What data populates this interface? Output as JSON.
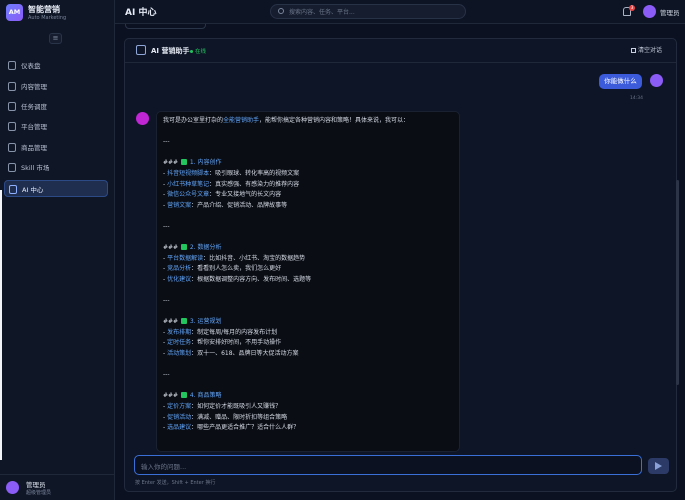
{
  "brand": {
    "logo": "AM",
    "name": "智能营销",
    "subtitle": "Auto Marketing"
  },
  "sidebar": {
    "collapse_icon": "≡",
    "items": [
      {
        "label": "仪表盘",
        "icon": "dashboard-icon",
        "active": false
      },
      {
        "label": "内容管理",
        "icon": "document-icon",
        "active": false
      },
      {
        "label": "任务调度",
        "icon": "clock-icon",
        "active": false
      },
      {
        "label": "平台管理",
        "icon": "platform-icon",
        "active": false
      },
      {
        "label": "商品管理",
        "icon": "box-icon",
        "active": false
      },
      {
        "label": "Skill 市场",
        "icon": "store-icon",
        "active": false
      },
      {
        "label": "AI 中心",
        "icon": "ai-icon",
        "active": true
      }
    ],
    "user": {
      "name": "管理员",
      "role": "超级管理员"
    }
  },
  "header": {
    "title": "AI 中心",
    "search_placeholder": "搜索内容、任务、平台...",
    "notifications": "3",
    "user": "管理员"
  },
  "chat": {
    "assistant_name": "AI 营销助手",
    "status": "在线",
    "clear_label": "清空对话",
    "user_message": "你能做什么",
    "user_time": "14:34",
    "bot_lines": [
      [
        {
          "t": "我可是办公室里打杂的"
        },
        {
          "t": "全能营销助手",
          "h": true
        },
        {
          "t": "，能帮你搞定各种营销内容和策略！具体来说，我可以："
        }
      ],
      [],
      [
        {
          "t": "---"
        }
      ],
      [],
      [
        {
          "t": "### "
        },
        {
          "c": true
        },
        {
          "t": " 1. 内容创作",
          "h": true
        }
      ],
      [
        {
          "t": "- "
        },
        {
          "t": "抖音短视频脚本",
          "h": true
        },
        {
          "t": "：吸引眼球、转化率高的视频文案"
        }
      ],
      [
        {
          "t": "- "
        },
        {
          "t": "小红书种草笔记",
          "h": true
        },
        {
          "t": "：真实感强、有感染力的推荐内容"
        }
      ],
      [
        {
          "t": "- "
        },
        {
          "t": "微信公众号文章",
          "h": true
        },
        {
          "t": "：专业又接地气的长文内容"
        }
      ],
      [
        {
          "t": "- "
        },
        {
          "t": "营销文案",
          "h": true
        },
        {
          "t": "：产品介绍、促销活动、品牌故事等"
        }
      ],
      [],
      [
        {
          "t": "---"
        }
      ],
      [],
      [
        {
          "t": "### "
        },
        {
          "c": true
        },
        {
          "t": " 2. 数据分析",
          "h": true
        }
      ],
      [
        {
          "t": "- "
        },
        {
          "t": "平台数据解读",
          "h": true
        },
        {
          "t": "：比如抖音、小红书、淘宝的数据趋势"
        }
      ],
      [
        {
          "t": "- "
        },
        {
          "t": "竞品分析",
          "h": true
        },
        {
          "t": "：看看别人怎么卖，我们怎么更好"
        }
      ],
      [
        {
          "t": "- "
        },
        {
          "t": "优化建议",
          "h": true
        },
        {
          "t": "：根据数据调整内容方向、发布时间、选题等"
        }
      ],
      [],
      [
        {
          "t": "---"
        }
      ],
      [],
      [
        {
          "t": "### "
        },
        {
          "c": true
        },
        {
          "t": " 3. 运营规划",
          "h": true
        }
      ],
      [
        {
          "t": "- "
        },
        {
          "t": "发布排期",
          "h": true
        },
        {
          "t": "：制定每周/每月的内容发布计划"
        }
      ],
      [
        {
          "t": "- "
        },
        {
          "t": "定时任务",
          "h": true
        },
        {
          "t": "：帮你安排好时间，不用手动操作"
        }
      ],
      [
        {
          "t": "- "
        },
        {
          "t": "活动策划",
          "h": true
        },
        {
          "t": "：双十一、618、品牌日等大促活动方案"
        }
      ],
      [],
      [
        {
          "t": "---"
        }
      ],
      [],
      [
        {
          "t": "### "
        },
        {
          "c": true
        },
        {
          "t": " 4. 商品策略",
          "h": true
        }
      ],
      [
        {
          "t": "- "
        },
        {
          "t": "定价方案",
          "h": true
        },
        {
          "t": "：如何定价才能既吸引人又赚钱？"
        }
      ],
      [
        {
          "t": "- "
        },
        {
          "t": "促销活动",
          "h": true
        },
        {
          "t": "：满减、赠品、限时折扣等组合策略"
        }
      ],
      [
        {
          "t": "- "
        },
        {
          "t": "选品建议",
          "h": true
        },
        {
          "t": "：哪些产品更适合推广？适合什么人群？"
        }
      ]
    ],
    "input_placeholder": "输入你的问题...",
    "hint": "按 Enter 发送，Shift + Enter 换行"
  },
  "colors": {
    "accent": "#3b5bdb",
    "highlight": "#60a5fa",
    "online": "#22c55e",
    "badge": "#ef4444"
  }
}
